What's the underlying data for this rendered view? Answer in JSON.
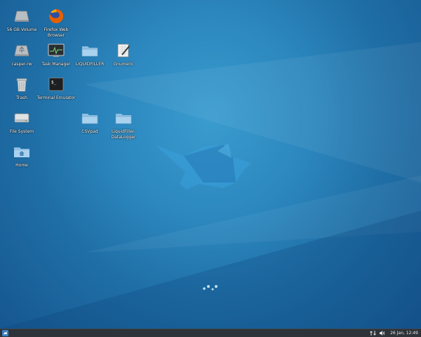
{
  "desktop": {
    "icons": [
      {
        "label": "56 GB Volume",
        "icon": "drive-icon"
      },
      {
        "label": "Firefox Web Browser",
        "icon": "firefox-icon"
      },
      {
        "label": "casper-rw",
        "icon": "drive-icon"
      },
      {
        "label": "Task Manager",
        "icon": "task-manager-icon"
      },
      {
        "label": "LIQUIDFILLER",
        "icon": "folder-icon"
      },
      {
        "label": "Gnumeric",
        "icon": "gnumeric-icon"
      },
      {
        "label": "Trash",
        "icon": "trash-icon"
      },
      {
        "label": "Terminal Emulator",
        "icon": "terminal-icon"
      },
      {
        "label": "File System",
        "icon": "harddisk-icon"
      },
      {
        "label": "CSVpad",
        "icon": "folder-icon"
      },
      {
        "label": "LiquidFiller-DataLogger",
        "icon": "folder-icon"
      },
      {
        "label": "Home",
        "icon": "home-folder-icon"
      }
    ]
  },
  "panel": {
    "clock": "26 Jan, 12:49",
    "menu_icon": "xfce-menu-icon",
    "tray_icons": [
      "network-icon",
      "volume-icon"
    ]
  },
  "colors": {
    "panel_bg": "#2d3338",
    "wallpaper": "#2b86bd"
  }
}
